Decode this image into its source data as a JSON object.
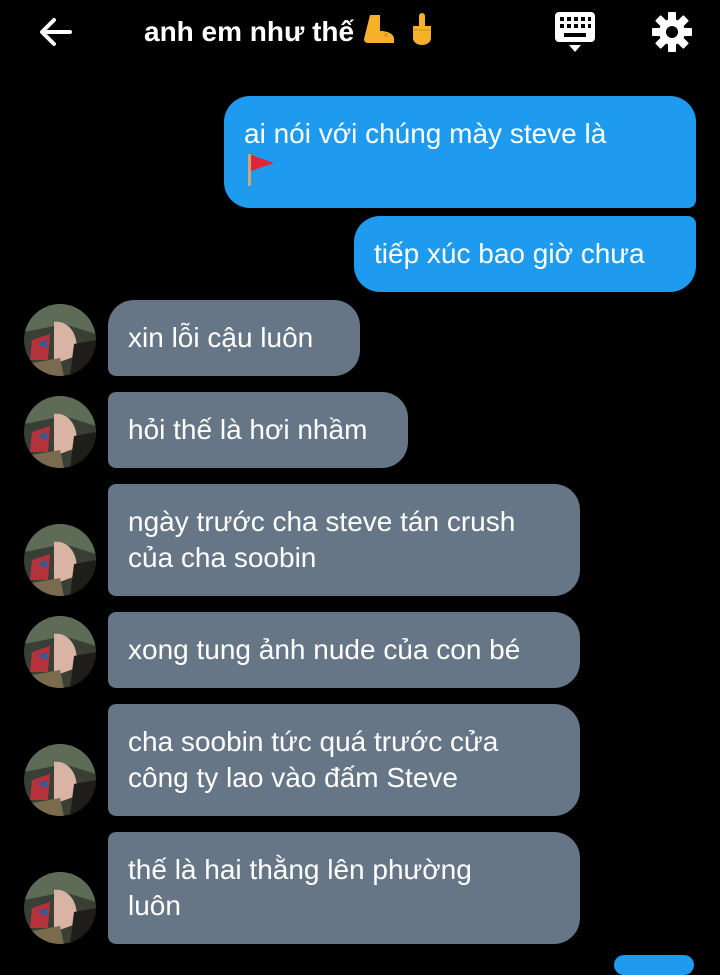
{
  "header": {
    "title": "anh em như thế",
    "title_emoji": "🦶🖕",
    "back_icon": "arrow-left-icon",
    "keyboard_icon": "keyboard-icon",
    "settings_icon": "gear-icon"
  },
  "colors": {
    "outgoing_bubble": "#1e9bef",
    "incoming_bubble": "#667686",
    "background": "#000000",
    "text": "#ffffff"
  },
  "messages": [
    {
      "side": "out",
      "text": "ai nói với chúng mày steve là",
      "extra_icon": "red-flag-icon"
    },
    {
      "side": "out",
      "text": "tiếp xúc bao giờ chưa"
    },
    {
      "side": "in",
      "text": "xin lỗi cậu luôn"
    },
    {
      "side": "in",
      "text": "hỏi thế là hơi nhầm"
    },
    {
      "side": "in",
      "text_lines": [
        "ngày trước cha steve tán crush",
        "của cha soobin"
      ]
    },
    {
      "side": "in",
      "text": "xong tung ảnh nude của con bé"
    },
    {
      "side": "in",
      "text_lines": [
        "cha soobin tức quá trước cửa",
        "công ty lao vào đấm Steve"
      ]
    },
    {
      "side": "in",
      "text_lines": [
        "thế là hai thằng lên phường",
        "luôn"
      ]
    }
  ]
}
